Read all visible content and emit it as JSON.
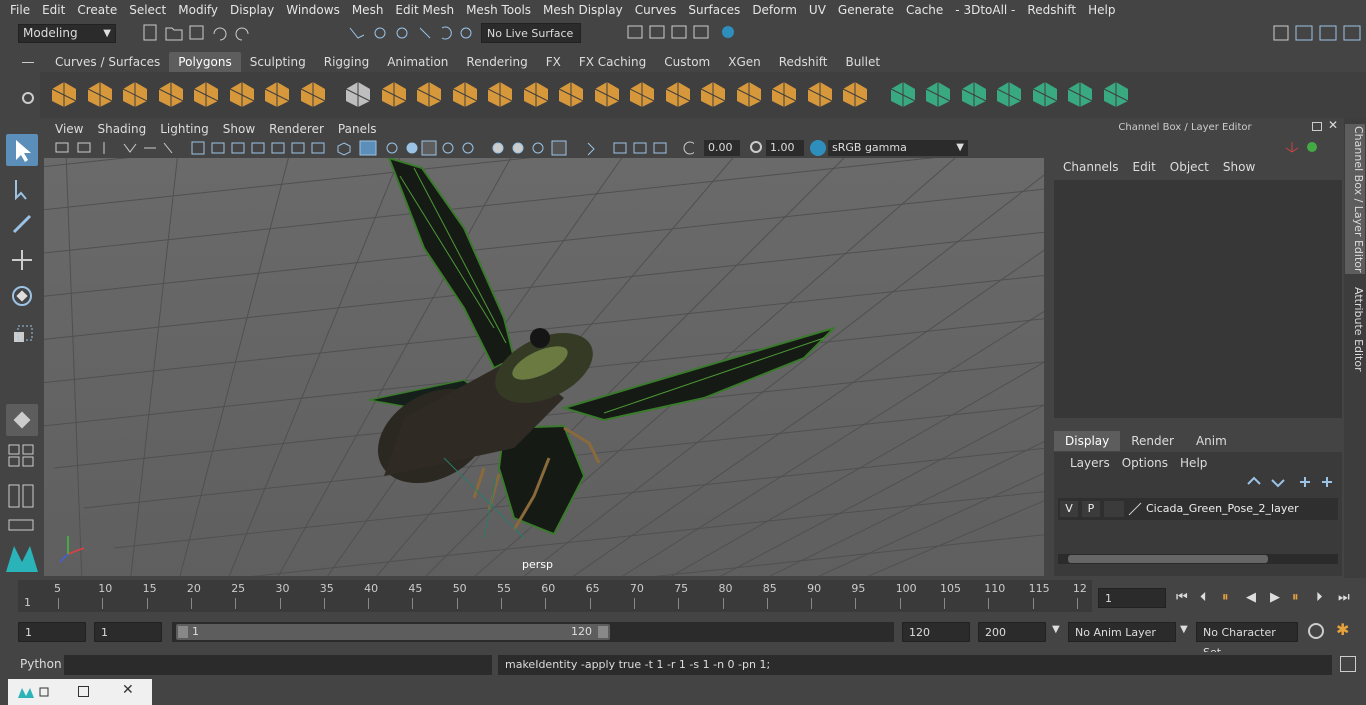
{
  "menubar": [
    "File",
    "Edit",
    "Create",
    "Select",
    "Modify",
    "Display",
    "Windows",
    "Mesh",
    "Edit Mesh",
    "Mesh Tools",
    "Mesh Display",
    "Curves",
    "Surfaces",
    "Deform",
    "UV",
    "Generate",
    "Cache",
    "- 3DtoAll -",
    "Redshift",
    "Help"
  ],
  "status": {
    "mode": "Modeling",
    "live_surface": "No Live Surface"
  },
  "shelf_tabs": [
    {
      "label": "Curves / Surfaces"
    },
    {
      "label": "Polygons",
      "active": true
    },
    {
      "label": "Sculpting"
    },
    {
      "label": "Rigging"
    },
    {
      "label": "Animation"
    },
    {
      "label": "Rendering"
    },
    {
      "label": "FX"
    },
    {
      "label": "FX Caching"
    },
    {
      "label": "Custom"
    },
    {
      "label": "XGen"
    },
    {
      "label": "Redshift"
    },
    {
      "label": "Bullet"
    }
  ],
  "panel_menu": [
    "View",
    "Shading",
    "Lighting",
    "Show",
    "Renderer",
    "Panels"
  ],
  "panel_toolbar": {
    "exposure": "0.00",
    "gamma": "1.00",
    "color_space": "sRGB gamma"
  },
  "viewport": {
    "camera_label": "persp"
  },
  "channel_box": {
    "title": "Channel Box / Layer Editor",
    "menu": [
      "Channels",
      "Edit",
      "Object",
      "Show"
    ]
  },
  "layer_editor": {
    "tabs": [
      {
        "label": "Display",
        "active": true
      },
      {
        "label": "Render"
      },
      {
        "label": "Anim"
      }
    ],
    "menu": [
      "Layers",
      "Options",
      "Help"
    ],
    "layer": {
      "v": "V",
      "p": "P",
      "name": "Cicada_Green_Pose_2_layer"
    }
  },
  "side_tabs": [
    "Channel Box / Layer Editor",
    "Attribute Editor"
  ],
  "timeline": {
    "ticks": [
      "5",
      "10",
      "15",
      "20",
      "25",
      "30",
      "35",
      "40",
      "45",
      "50",
      "55",
      "60",
      "65",
      "70",
      "75",
      "80",
      "85",
      "90",
      "95",
      "100",
      "105",
      "110",
      "115",
      "12"
    ],
    "start_marker": "1",
    "current_frame": "1"
  },
  "range": {
    "start_frame": "1",
    "start_playback": "1",
    "slider_start": "1",
    "slider_end": "120",
    "end_playback": "120",
    "end_frame": "200",
    "anim_layer": "No Anim Layer",
    "character_set": "No Character Set"
  },
  "command": {
    "language": "Python",
    "result": "makeIdentity -apply true -t 1 -r 1 -s 1 -n 0 -pn 1;"
  },
  "colors": {
    "accent": "#5b8eb8",
    "shelf_icon_orange": "#e8a23c",
    "shelf_icon_green": "#39b58a",
    "panel": "#444444",
    "field": "#2b2b2b"
  }
}
